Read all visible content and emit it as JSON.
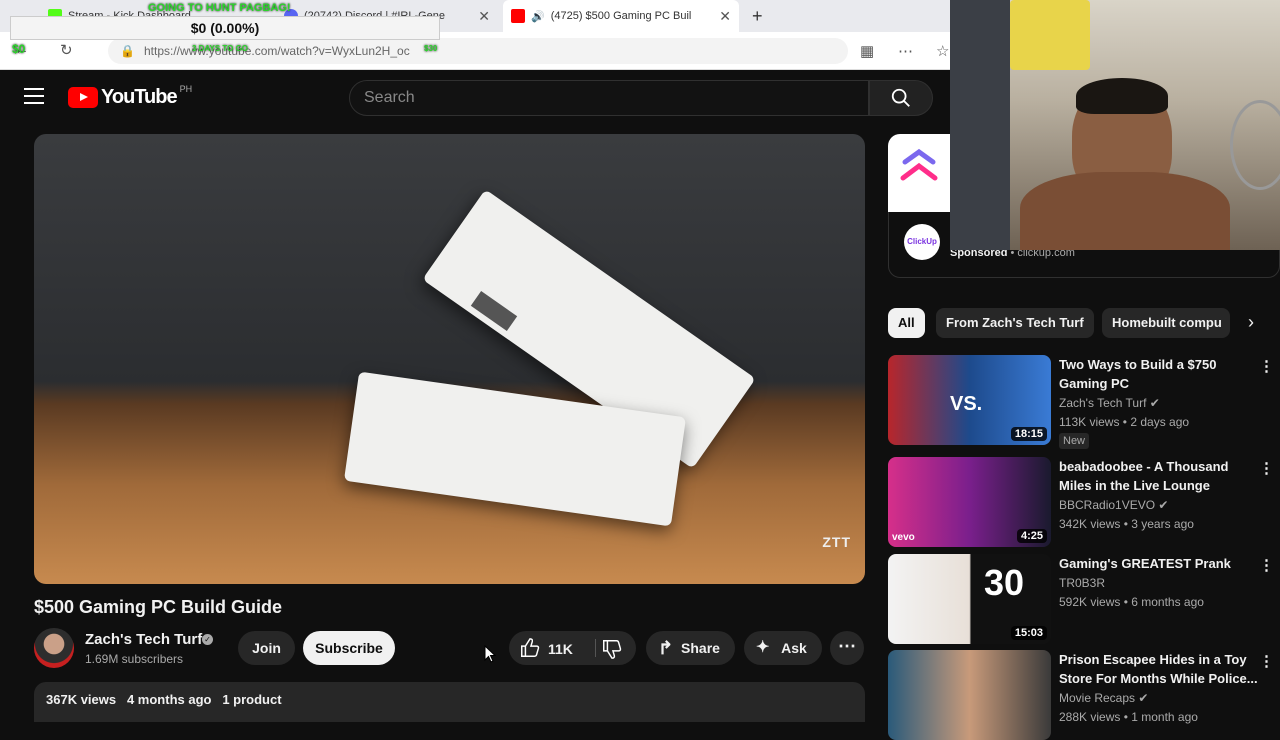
{
  "browser": {
    "tabs": [
      {
        "label": "Stream - Kick Dashboard"
      },
      {
        "label": "(20742) Discord | #IRL-Gene"
      },
      {
        "label": "(4725) $500 Gaming PC Buil"
      }
    ],
    "new_tab": "+",
    "url": "https://www.youtube.com/watch?v=WyxLun2H_oc"
  },
  "overlay": {
    "amount": "$0 (0.00%)",
    "goal_text": "GOING TO HUNT PAGBAG!",
    "left_amount": "$0",
    "days_text": "3 DAYS TO GO",
    "right_amount": "$30"
  },
  "youtube": {
    "logo_text": "YouTube",
    "country": "PH",
    "search_placeholder": "Search"
  },
  "video": {
    "title": "$500 Gaming PC Build Guide",
    "watermark": "ZTT",
    "channel": "Zach's Tech Turf",
    "subscribers": "1.69M subscribers",
    "join": "Join",
    "subscribe": "Subscribe",
    "likes": "11K",
    "share": "Share",
    "ask": "Ask",
    "views": "367K views",
    "age": "4 months ago",
    "products": "1 product"
  },
  "sidebar": {
    "ad": {
      "avatar_text": "ClickUp",
      "sponsored": "Sponsored",
      "domain": "clickup.com"
    },
    "chips": [
      "All",
      "From Zach's Tech Turf",
      "Homebuilt compu"
    ],
    "recommendations": [
      {
        "title": "Two Ways to Build a $750 Gaming PC",
        "channel": "Zach's Tech Turf",
        "stats": "113K views • 2 days ago",
        "badge": "New",
        "duration": "18:15"
      },
      {
        "title": "beabadoobee - A Thousand Miles in the Live Lounge",
        "channel": "BBCRadio1VEVO",
        "stats": "342K views • 3 years ago",
        "duration": "4:25"
      },
      {
        "title": "Gaming's GREATEST Prank",
        "channel": "TR0B3R",
        "stats": "592K views • 6 months ago",
        "duration": "15:03"
      },
      {
        "title": "Prison Escapee Hides in a Toy Store For Months While Police...",
        "channel": "Movie Recaps",
        "stats": "288K views • 1 month ago"
      }
    ]
  }
}
